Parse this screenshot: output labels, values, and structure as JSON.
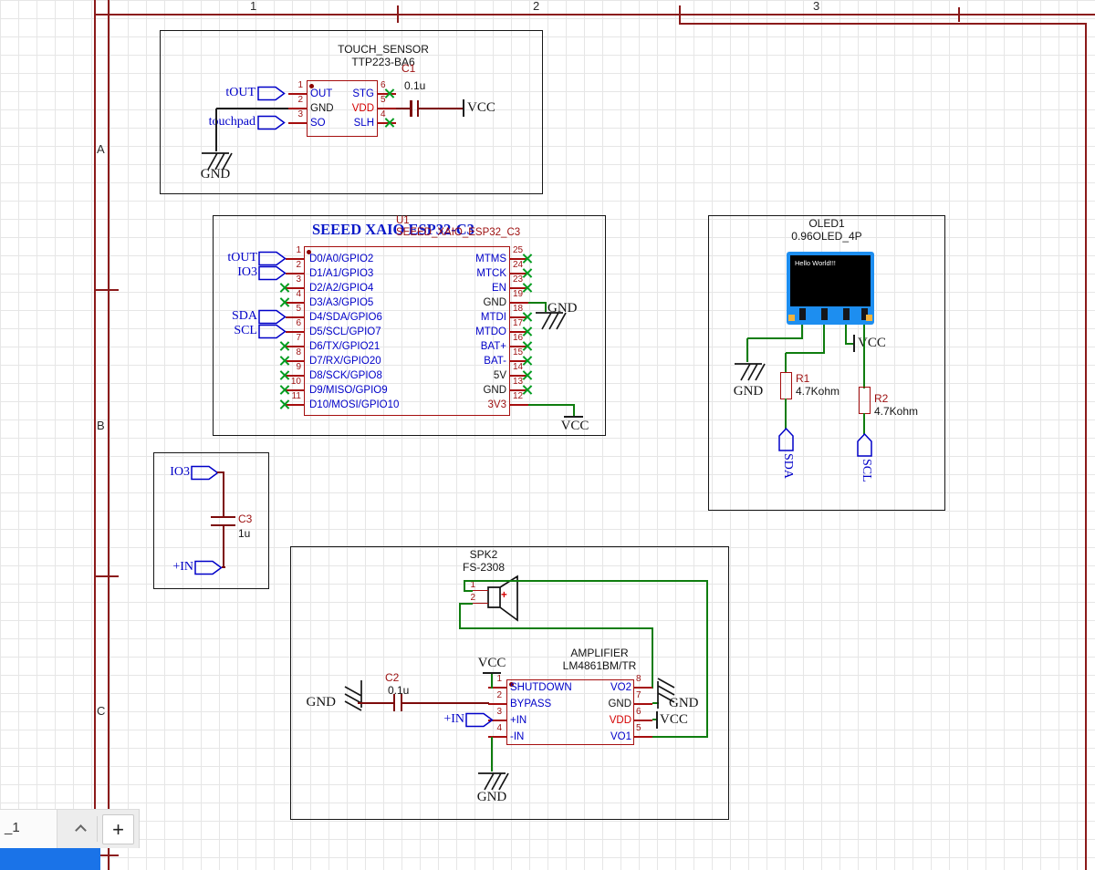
{
  "frame": {
    "col_labels": [
      "1",
      "2",
      "3"
    ],
    "row_labels": [
      "A",
      "B",
      "C"
    ]
  },
  "sheet_bar": {
    "tab_label": "_1",
    "add_button": "+"
  },
  "colors": {
    "wire_green": "#0f7d0f",
    "wire_dark_red": "#7d0b0b",
    "chip_outline": "#a50e0e",
    "net_flag_blue": "#0000c8",
    "no_connect_green": "#009c20",
    "frame_red": "#8b1a1a",
    "taskbar_blue": "#1a73e8",
    "oled_frame_blue": "#1d8ef0"
  },
  "touch_sensor": {
    "title": "TOUCH_SENSOR",
    "part": "TTP223-BA6",
    "cap_ref": "C1",
    "cap_val": "0.1u",
    "left_pins": [
      {
        "num": "1",
        "name": "OUT"
      },
      {
        "num": "2",
        "name": "GND"
      },
      {
        "num": "3",
        "name": "SO"
      }
    ],
    "right_pins": [
      {
        "num": "6",
        "name": "STG"
      },
      {
        "num": "5",
        "name": "VDD"
      },
      {
        "num": "4",
        "name": "SLH"
      }
    ],
    "flag_tout": "tOUT",
    "flag_touchpad": "touchpad",
    "gnd_label": "GND",
    "vcc_label": "VCC"
  },
  "xiao": {
    "title": "SEEED XAIO ESP32-C3",
    "refdes": "U1",
    "part": "SEEED_XAIO_ESP32_C3",
    "left_pins": [
      {
        "num": "1",
        "name": "D0/A0/GPIO2"
      },
      {
        "num": "2",
        "name": "D1/A1/GPIO3"
      },
      {
        "num": "3",
        "name": "D2/A2/GPIO4"
      },
      {
        "num": "4",
        "name": "D3/A3/GPIO5"
      },
      {
        "num": "5",
        "name": "D4/SDA/GPIO6"
      },
      {
        "num": "6",
        "name": "D5/SCL/GPIO7"
      },
      {
        "num": "7",
        "name": "D6/TX/GPIO21"
      },
      {
        "num": "8",
        "name": "D7/RX/GPIO20"
      },
      {
        "num": "9",
        "name": "D8/SCK/GPIO8"
      },
      {
        "num": "10",
        "name": "D9/MISO/GPIO9"
      },
      {
        "num": "11",
        "name": "D10/MOSI/GPIO10"
      }
    ],
    "right_pins": [
      {
        "num": "25",
        "name": "MTMS"
      },
      {
        "num": "24",
        "name": "MTCK"
      },
      {
        "num": "23",
        "name": "EN"
      },
      {
        "num": "19",
        "name": "GND"
      },
      {
        "num": "18",
        "name": "MTDI"
      },
      {
        "num": "17",
        "name": "MTDO"
      },
      {
        "num": "16",
        "name": "BAT+"
      },
      {
        "num": "15",
        "name": "BAT-"
      },
      {
        "num": "14",
        "name": "5V"
      },
      {
        "num": "13",
        "name": "GND"
      },
      {
        "num": "12",
        "name": "3V3"
      }
    ],
    "flags": {
      "tout": "tOUT",
      "io3": "IO3",
      "sda": "SDA",
      "scl": "SCL"
    },
    "gnd_label": "GND",
    "vcc_label": "VCC"
  },
  "oled": {
    "refdes": "OLED1",
    "part": "0.96OLED_4P",
    "screen_text": "Hello World!!!",
    "r1_ref": "R1",
    "r1_val": "4.7Kohm",
    "r2_ref": "R2",
    "r2_val": "4.7Kohm",
    "flag_sda": "SDA",
    "flag_scl": "SCL",
    "gnd_label": "GND",
    "vcc_label": "VCC"
  },
  "c3_block": {
    "flag_io3": "IO3",
    "cap_ref": "C3",
    "cap_val": "1u",
    "flag_in": "+IN"
  },
  "amp": {
    "spk_ref": "SPK2",
    "spk_part": "FS-2308",
    "spk_pins": [
      "1",
      "2"
    ],
    "spk_plus": "+",
    "title": "AMPLIFIER",
    "part": "LM4861BM/TR",
    "cap_ref": "C2",
    "cap_val": "0.1u",
    "left_pins": [
      {
        "num": "1",
        "name": "SHUTDOWN"
      },
      {
        "num": "2",
        "name": "BYPASS"
      },
      {
        "num": "3",
        "name": "+IN"
      },
      {
        "num": "4",
        "name": "-IN"
      }
    ],
    "right_pins": [
      {
        "num": "8",
        "name": "VO2"
      },
      {
        "num": "7",
        "name": "GND"
      },
      {
        "num": "6",
        "name": "VDD"
      },
      {
        "num": "5",
        "name": "VO1"
      }
    ],
    "flag_in": "+IN",
    "vcc_top": "VCC",
    "gnd_c2": "GND",
    "gnd_bottom": "GND",
    "gnd_right": "GND",
    "vcc_right": "VCC"
  }
}
